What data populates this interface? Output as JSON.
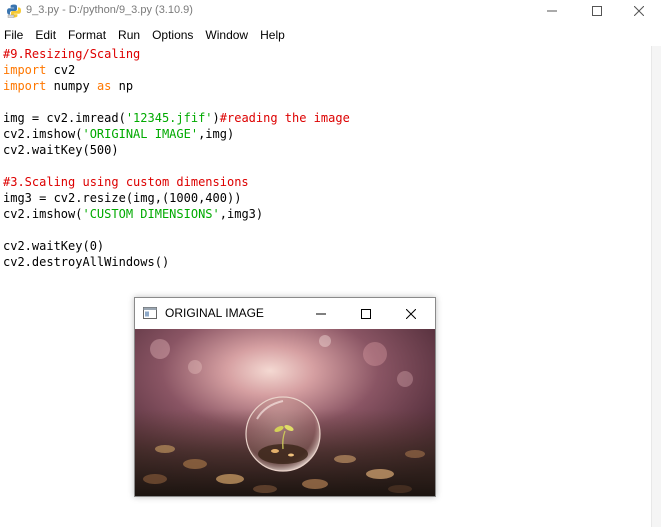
{
  "window": {
    "title": "9_3.py - D:/python/9_3.py (3.10.9)"
  },
  "menu": {
    "items": [
      "File",
      "Edit",
      "Format",
      "Run",
      "Options",
      "Window",
      "Help"
    ]
  },
  "code_lines": [
    [
      {
        "t": "#9.Resizing/Scaling",
        "c": "comment"
      }
    ],
    [
      {
        "t": "import",
        "c": "kw"
      },
      {
        "t": " cv2",
        "c": "plain"
      }
    ],
    [
      {
        "t": "import",
        "c": "kw"
      },
      {
        "t": " numpy ",
        "c": "plain"
      },
      {
        "t": "as",
        "c": "kw"
      },
      {
        "t": " np",
        "c": "plain"
      }
    ],
    [],
    [
      {
        "t": "img = cv2.imread(",
        "c": "plain"
      },
      {
        "t": "'12345.jfif'",
        "c": "str"
      },
      {
        "t": ")",
        "c": "plain"
      },
      {
        "t": "#reading the image",
        "c": "comment"
      }
    ],
    [
      {
        "t": "cv2.imshow(",
        "c": "plain"
      },
      {
        "t": "'ORIGINAL IMAGE'",
        "c": "str"
      },
      {
        "t": ",img)",
        "c": "plain"
      }
    ],
    [
      {
        "t": "cv2.waitKey(500)",
        "c": "plain"
      }
    ],
    [],
    [
      {
        "t": "#3.Scaling using custom dimensions",
        "c": "comment"
      }
    ],
    [
      {
        "t": "img3 = cv2.resize(img,(1000,400))",
        "c": "plain"
      }
    ],
    [
      {
        "t": "cv2.imshow(",
        "c": "plain"
      },
      {
        "t": "'CUSTOM DIMENSIONS'",
        "c": "str"
      },
      {
        "t": ",img3)",
        "c": "plain"
      }
    ],
    [],
    [
      {
        "t": "cv2.waitKey(0)",
        "c": "plain"
      }
    ],
    [
      {
        "t": "cv2.destroyAllWindows()",
        "c": "plain"
      }
    ]
  ],
  "cv_window": {
    "title": "ORIGINAL IMAGE"
  },
  "colors": {
    "comment": "#dd0000",
    "keyword": "#ff7700",
    "string": "#00aa00"
  },
  "icons": {
    "app": "python-idle-icon",
    "cv": "opencv-window-icon"
  }
}
